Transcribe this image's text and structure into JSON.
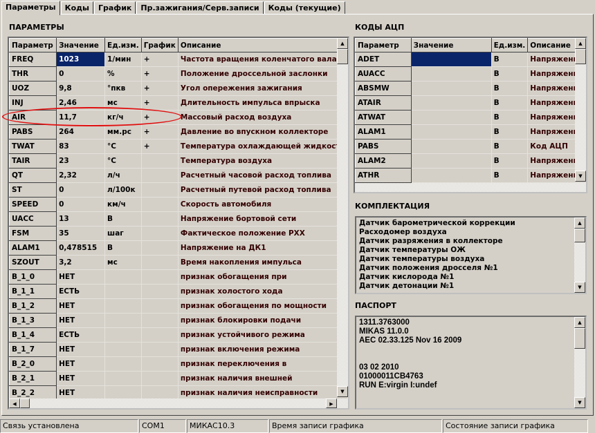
{
  "tabs": [
    "Параметры",
    "Коды",
    "График",
    "Пр.зажигания/Серв.записи",
    "Коды (текущие)"
  ],
  "params": {
    "title": "ПАРАМЕТРЫ",
    "headers": [
      "Параметр",
      "Значение",
      "Ед.изм.",
      "График",
      "Описание"
    ],
    "rows": [
      [
        "FREQ",
        "1023",
        "1/мин",
        "+",
        "Частота вращения коленчатого вала"
      ],
      [
        "THR",
        "0",
        "%",
        "+",
        "Положение дроссельной заслонки"
      ],
      [
        "UOZ",
        "9,8",
        "°пкв",
        "+",
        "Угол опережения зажигания"
      ],
      [
        "INJ",
        "2,46",
        "мс",
        "+",
        "Длительность импульса впрыска"
      ],
      [
        "AIR",
        "11,7",
        "кг/ч",
        "+",
        "Массовый расход воздуха"
      ],
      [
        "PABS",
        "264",
        "мм.рс",
        "+",
        "Давление во впускном коллекторе"
      ],
      [
        "TWAT",
        "83",
        "°С",
        "+",
        "Температура охлаждающей жидкости"
      ],
      [
        "TAIR",
        "23",
        "°С",
        "",
        "Температура воздуха"
      ],
      [
        "QT",
        "2,32",
        "л/ч",
        "",
        "Расчетный часовой расход топлива"
      ],
      [
        "ST",
        "0",
        "л/100к",
        "",
        "Расчетный путевой расход топлива"
      ],
      [
        "SPEED",
        "0",
        "км/ч",
        "",
        "Скорость автомобиля"
      ],
      [
        "UACC",
        "13",
        "В",
        "",
        "Напряжение бортовой сети"
      ],
      [
        "FSM",
        "35",
        "шаг",
        "",
        "Фактическое положение РХХ"
      ],
      [
        "ALAM1",
        "0,478515",
        "В",
        "",
        "Напряжение на ДК1"
      ],
      [
        "SZOUT",
        "3,2",
        "мс",
        "",
        "Время накопления импульса"
      ],
      [
        "B_1_0",
        "НЕТ",
        "",
        "",
        "признак обогащения при"
      ],
      [
        "B_1_1",
        "ЕСТЬ",
        "",
        "",
        "признак холостого хода"
      ],
      [
        "B_1_2",
        "НЕТ",
        "",
        "",
        "признак обогащения по мощности"
      ],
      [
        "B_1_3",
        "НЕТ",
        "",
        "",
        "признак блокировки подачи"
      ],
      [
        "B_1_4",
        "ЕСТЬ",
        "",
        "",
        "признак устойчивого режима"
      ],
      [
        "B_1_7",
        "НЕТ",
        "",
        "",
        "признак включения режима"
      ],
      [
        "B_2_0",
        "НЕТ",
        "",
        "",
        "признак переключения в"
      ],
      [
        "B_2_1",
        "НЕТ",
        "",
        "",
        "признак наличия внешней"
      ],
      [
        "B_2_2",
        "НЕТ",
        "",
        "",
        "признак наличия неисправности"
      ]
    ]
  },
  "adc": {
    "title": "КОДЫ АЦП",
    "headers": [
      "Параметр",
      "Значение",
      "Ед.изм.",
      "Описание"
    ],
    "rows": [
      [
        "ADET",
        "",
        "В",
        "Напряжение"
      ],
      [
        "AUACC",
        "",
        "В",
        "Напряжение"
      ],
      [
        "ABSMW",
        "",
        "В",
        "Напряжение"
      ],
      [
        "ATAIR",
        "",
        "В",
        "Напряжение"
      ],
      [
        "ATWAT",
        "",
        "В",
        "Напряжение"
      ],
      [
        "ALAM1",
        "",
        "В",
        "Напряжение"
      ],
      [
        "PABS",
        "",
        "В",
        "Код АЦП"
      ],
      [
        "ALAM2",
        "",
        "В",
        "Напряжение"
      ],
      [
        "ATHR",
        "",
        "В",
        "Напряжение"
      ]
    ]
  },
  "equipment": {
    "title": "КОМПЛЕКТАЦИЯ",
    "items": [
      "Датчик барометрической коррекции",
      "Расходомер воздуха",
      "Датчик разряжения в коллекторе",
      "Датчик температуры ОЖ",
      "Датчик температуры воздуха",
      "Датчик положения дросселя №1",
      "Датчик кислорода №1",
      "Датчик детонации №1"
    ]
  },
  "passport": {
    "title": "ПАСПОРТ",
    "lines": [
      "1311.3763000",
      "MIKAS 11.0.0",
      "AEC 02.33.125  Nov 16 2009",
      "",
      "",
      "03 02 2010",
      "01000011CB4763",
      "RUN  E:virgin  I:undef"
    ]
  },
  "status": [
    "Связь установлена",
    "COM1",
    "МИКАС10.3",
    "Время записи графика",
    "Состояние записи графика"
  ],
  "colors": {
    "selection": "#0a246a",
    "highlight_ellipse": "#e01010"
  }
}
